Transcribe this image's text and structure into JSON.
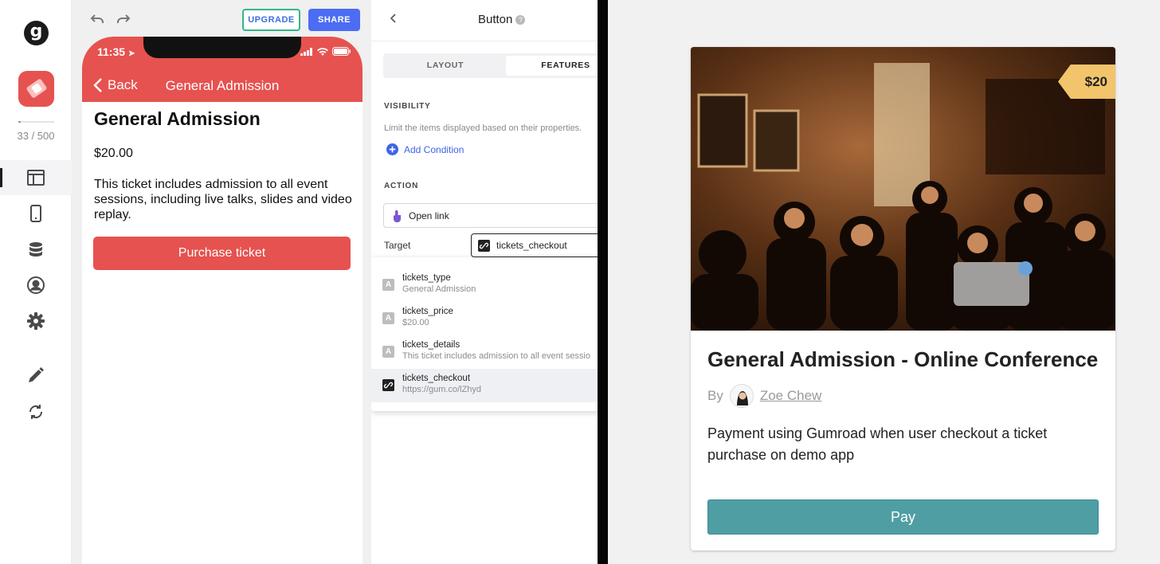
{
  "rail": {
    "logo": "g",
    "usage": {
      "text": "33 / 500",
      "used": 33,
      "limit": 500
    },
    "items": [
      {
        "name": "layout-icon",
        "active": true
      },
      {
        "name": "phone-icon",
        "active": false
      },
      {
        "name": "database-icon",
        "active": false
      },
      {
        "name": "user-icon",
        "active": false
      },
      {
        "name": "gear-icon",
        "active": false
      },
      {
        "name": "pencil-icon",
        "active": false
      },
      {
        "name": "sync-icon",
        "active": false
      }
    ]
  },
  "toolbar": {
    "upgrade_label": "UPGRADE",
    "share_label": "SHARE"
  },
  "phone": {
    "status_time": "11:35",
    "back_label": "Back",
    "nav_title": "General Admission",
    "title": "General Admission",
    "price": "$20.00",
    "description": "This ticket includes admission to all event sessions, including live talks, slides and video replay.",
    "button_label": "Purchase ticket",
    "accent": "#e6524f"
  },
  "panel": {
    "title": "Button",
    "tabs": [
      {
        "label": "LAYOUT",
        "active": false
      },
      {
        "label": "FEATURES",
        "active": true
      }
    ],
    "visibility_label": "VISIBILITY",
    "visibility_desc": "Limit the items displayed based on their properties.",
    "add_condition_label": "Add Condition",
    "action_label": "ACTION",
    "action_value": "Open link",
    "target_label": "Target",
    "target_value": "tickets_checkout",
    "options": [
      {
        "icon": "A",
        "name": "tickets_type",
        "value": "General Admission",
        "selected": false
      },
      {
        "icon": "A",
        "name": "tickets_price",
        "value": "$20.00",
        "selected": false
      },
      {
        "icon": "A",
        "name": "tickets_details",
        "value": "This ticket includes admission to all event sessio",
        "selected": false
      },
      {
        "icon": "link",
        "name": "tickets_checkout",
        "value": "https://gum.co/lZhyd",
        "selected": true
      }
    ]
  },
  "card": {
    "price_tag": "$20",
    "title": "General Admission - Online Conference",
    "by_label": "By",
    "author": "Zoe Chew",
    "description": "Payment using Gumroad when user checkout a ticket purchase on demo app",
    "pay_label": "Pay",
    "pay_color": "#4f9ea4",
    "tag_color": "#f2c46b"
  }
}
